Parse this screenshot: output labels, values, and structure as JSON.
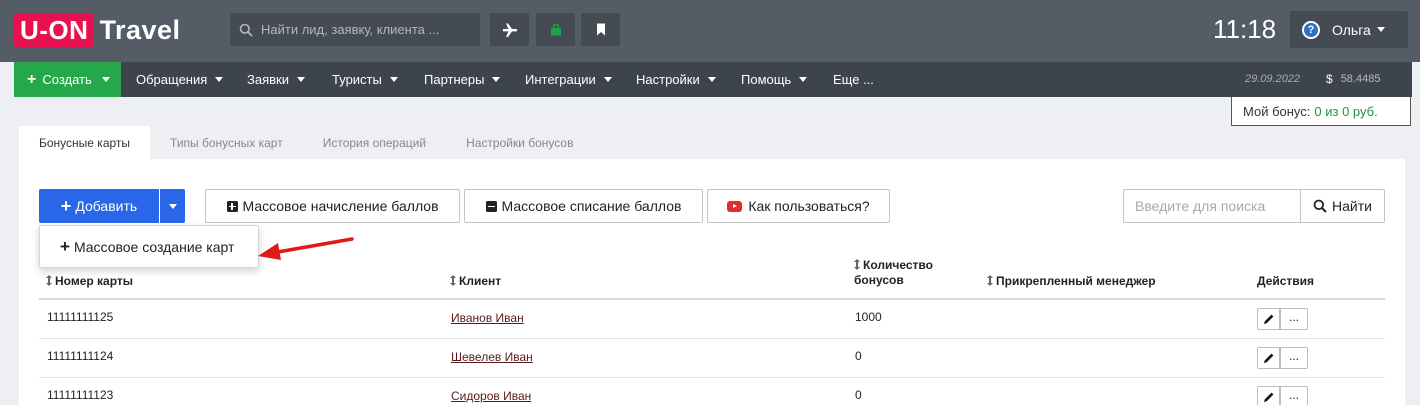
{
  "app": {
    "logo_box": "U-ON",
    "logo_text": "Travel"
  },
  "topbar": {
    "search_placeholder": "Найти лид, заявку, клиента ...",
    "clock": "11:18",
    "help_glyph": "?",
    "user_name": "Ольга"
  },
  "nav": {
    "create_label": "Создать",
    "items": [
      "Обращения",
      "Заявки",
      "Туристы",
      "Партнеры",
      "Интеграции",
      "Настройки",
      "Помощь",
      "Еще ..."
    ],
    "date": "29.09.2022",
    "currency_symbol": "$",
    "rate": "58.4485"
  },
  "bonus": {
    "label": "Мой бонус:",
    "value": "0 из 0 руб."
  },
  "tabs": [
    "Бонусные карты",
    "Типы бонусных карт",
    "История операций",
    "Настройки бонусов"
  ],
  "toolbar": {
    "add_label": "Добавить",
    "mass_credit_label": "Массовое начисление баллов",
    "mass_debit_label": "Массовое списание баллов",
    "howto_label": "Как пользоваться?",
    "search_placeholder": "Введите для поиска",
    "search_button": "Найти"
  },
  "dropdown": {
    "mass_create_label": "Массовое создание карт"
  },
  "table": {
    "columns": {
      "card_number": "Номер карты",
      "client": "Клиент",
      "bonus_count_line1": "Количество",
      "bonus_count_line2": "бонусов",
      "manager": "Прикрепленный менеджер",
      "actions": "Действия"
    },
    "rows": [
      {
        "card_number": "11111111125",
        "client": "Иванов Иван",
        "bonus": "1000",
        "manager": ""
      },
      {
        "card_number": "11111111124",
        "client": "Шевелев Иван",
        "bonus": "0",
        "manager": ""
      },
      {
        "card_number": "11111111123",
        "client": "Сидоров Иван",
        "bonus": "0",
        "manager": ""
      }
    ],
    "more_label": "..."
  },
  "colors": {
    "brand": "#e8114f",
    "topbar": "#545c65",
    "navbar": "#3d444c",
    "create_green": "#25a84b",
    "primary_blue": "#2a66e8",
    "annotation_arrow": "#e01919"
  }
}
